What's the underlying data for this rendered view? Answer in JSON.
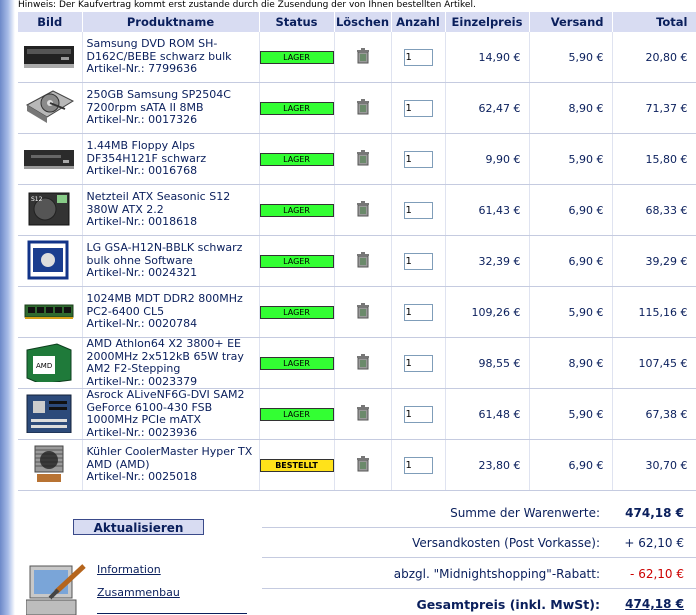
{
  "hinweis": "Hinweis: Der Kaufvertrag kommt erst zustande durch die Zusendung der von Ihnen bestellten Artikel.",
  "columns": {
    "bild": "Bild",
    "produktname": "Produktname",
    "status": "Status",
    "loeschen": "Löschen",
    "anzahl": "Anzahl",
    "einzelpreis": "Einzelpreis",
    "versand": "Versand",
    "total": "Total"
  },
  "items": [
    {
      "name": "Samsung DVD ROM SH-D162C/BEBE schwarz bulk",
      "artnr": "Artikel-Nr.: 7799636",
      "status": "LAGER",
      "qty": "1",
      "einzelpreis": "14,90 €",
      "versand": "5,90 €",
      "total": "20,80 €",
      "image": "dvd-drive"
    },
    {
      "name": "250GB Samsung SP2504C 7200rpm sATA II 8MB",
      "artnr": "Artikel-Nr.: 0017326",
      "status": "LAGER",
      "qty": "1",
      "einzelpreis": "62,47 €",
      "versand": "8,90 €",
      "total": "71,37 €",
      "image": "hard-disk"
    },
    {
      "name": "1.44MB Floppy Alps DF354H121F schwarz",
      "artnr": "Artikel-Nr.: 0016768",
      "status": "LAGER",
      "qty": "1",
      "einzelpreis": "9,90 €",
      "versand": "5,90 €",
      "total": "15,80 €",
      "image": "floppy-drive"
    },
    {
      "name": "Netzteil ATX Seasonic S12 380W ATX 2.2",
      "artnr": "Artikel-Nr.: 0018618",
      "status": "LAGER",
      "qty": "1",
      "einzelpreis": "61,43 €",
      "versand": "6,90 €",
      "total": "68,33 €",
      "image": "power-supply"
    },
    {
      "name": "LG GSA-H12N-BBLK schwarz bulk ohne Software",
      "artnr": "Artikel-Nr.: 0024321",
      "status": "LAGER",
      "qty": "1",
      "einzelpreis": "32,39 €",
      "versand": "6,90 €",
      "total": "39,29 €",
      "image": "lg-box"
    },
    {
      "name": "1024MB MDT DDR2 800MHz PC2-6400 CL5",
      "artnr": "Artikel-Nr.: 0020784",
      "status": "LAGER",
      "qty": "1",
      "einzelpreis": "109,26 €",
      "versand": "5,90 €",
      "total": "115,16 €",
      "image": "ram-module"
    },
    {
      "name": "AMD Athlon64 X2 3800+ EE 2000MHz 2x512kB 65W tray AM2 F2-Stepping",
      "artnr": "Artikel-Nr.: 0023379",
      "status": "LAGER",
      "qty": "1",
      "einzelpreis": "98,55 €",
      "versand": "8,90 €",
      "total": "107,45 €",
      "image": "cpu-box"
    },
    {
      "name": "Asrock ALiveNF6G-DVI SAM2 GeForce 6100-430 FSB 1000MHz PCIe mATX",
      "artnr": "Artikel-Nr.: 0023936",
      "status": "LAGER",
      "qty": "1",
      "einzelpreis": "61,48 €",
      "versand": "5,90 €",
      "total": "67,38 €",
      "image": "mainboard"
    },
    {
      "name": "Kühler CoolerMaster Hyper TX AMD (AMD)",
      "artnr": "Artikel-Nr.: 0025018",
      "status": "BESTELLT",
      "qty": "1",
      "einzelpreis": "23,80 €",
      "versand": "6,90 €",
      "total": "30,70 €",
      "image": "cpu-cooler"
    }
  ],
  "update_button": "Aktualisieren",
  "links": {
    "information": "Information",
    "zusammenbau": "Zusammenbau"
  },
  "summary": {
    "warenwerte_label": "Summe der Warenwerte:",
    "warenwerte_value": "474,18 €",
    "versand_label": "Versandkosten (Post Vorkasse):",
    "versand_value": "+ 62,10 €",
    "rabatt_label": "abzgl. \"Midnightshopping\"-Rabatt:",
    "rabatt_value": "- 62,10 €",
    "gesamt_label": "Gesamtpreis (inkl. MwSt):",
    "gesamt_value": "474,18 €"
  },
  "colors": {
    "header_bg": "#d8dcf2",
    "text": "#0a1f5c",
    "lager": "#33ff33",
    "bestellt": "#ffe21a",
    "discount": "#cc0000"
  }
}
